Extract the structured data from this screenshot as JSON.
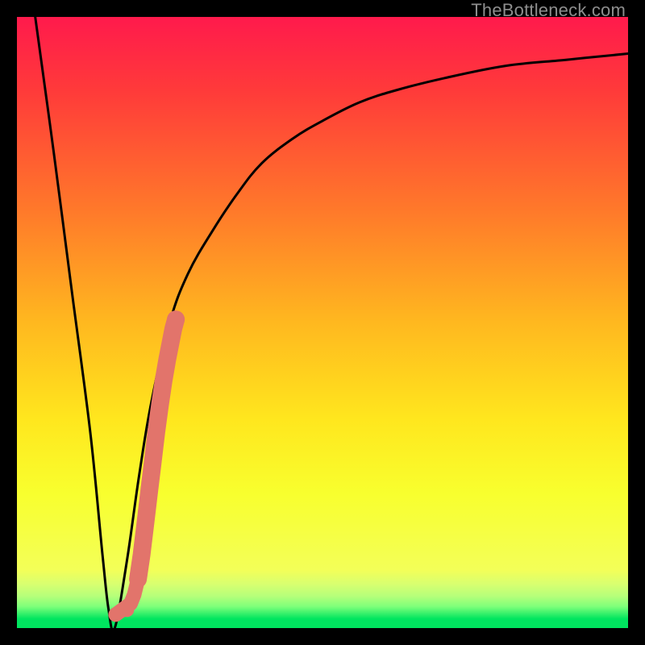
{
  "watermark": "TheBottleneck.com",
  "colors": {
    "frame": "#000000",
    "curve": "#000000",
    "marker": "#e2746b",
    "green": "#00e55f",
    "gradient_stops": [
      {
        "offset": 0.0,
        "color": "#ff1a4c"
      },
      {
        "offset": 0.12,
        "color": "#ff3a3a"
      },
      {
        "offset": 0.32,
        "color": "#ff7a2a"
      },
      {
        "offset": 0.5,
        "color": "#ffb81f"
      },
      {
        "offset": 0.66,
        "color": "#ffe71e"
      },
      {
        "offset": 0.78,
        "color": "#f8ff2e"
      },
      {
        "offset": 0.905,
        "color": "#f3ff58"
      },
      {
        "offset": 0.928,
        "color": "#d8ff70"
      },
      {
        "offset": 0.948,
        "color": "#b5ff7a"
      },
      {
        "offset": 0.965,
        "color": "#7dff7a"
      },
      {
        "offset": 0.985,
        "color": "#00e55f"
      },
      {
        "offset": 1.0,
        "color": "#00e55f"
      }
    ]
  },
  "chart_data": {
    "type": "line",
    "title": "",
    "xlabel": "",
    "ylabel": "",
    "xlim": [
      0,
      100
    ],
    "ylim": [
      0,
      100
    ],
    "series": [
      {
        "name": "bottleneck-curve",
        "x": [
          3,
          6,
          9,
          12,
          14,
          15,
          16,
          18,
          20,
          22,
          25,
          28,
          32,
          36,
          40,
          45,
          50,
          56,
          62,
          70,
          80,
          90,
          100
        ],
        "y": [
          100,
          78,
          55,
          32,
          12,
          3,
          0,
          11,
          25,
          37,
          50,
          58,
          65,
          71,
          76,
          80,
          83,
          86,
          88,
          90,
          92,
          93,
          94
        ]
      }
    ],
    "markers": {
      "name": "highlight-segment",
      "x": [
        18.0,
        18.6,
        19.2,
        19.8,
        20.4,
        21.0,
        21.6,
        22.2,
        22.8,
        23.4,
        24.0,
        24.6,
        25.2,
        25.6,
        26.0
      ],
      "y": [
        3.0,
        4.0,
        5.5,
        8.0,
        12.0,
        17.0,
        22.0,
        27.0,
        32.0,
        36.5,
        40.5,
        44.0,
        47.0,
        49.0,
        50.5
      ]
    }
  }
}
